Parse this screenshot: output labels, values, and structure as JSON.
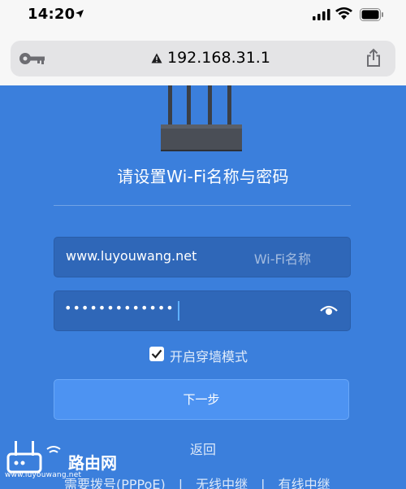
{
  "status_bar": {
    "time": "14:20"
  },
  "browser": {
    "url": "192.168.31.1"
  },
  "setup": {
    "title": "请设置Wi-Fi名称与密码",
    "ssid_value": "www.luyouwang.net",
    "ssid_hint": "Wi-Fi名称",
    "password_masked": "•••••••••••••",
    "wall_mode_label": "开启穿墙模式",
    "wall_mode_checked": true,
    "next_button": "下一步",
    "back_link": "返回",
    "links": [
      "需要拨号(PPPoE)",
      "无线中继",
      "有线中继"
    ]
  },
  "watermark": {
    "brand": "路由网",
    "url": "www.luyouwang.net"
  },
  "icons": {
    "key": "key-icon",
    "warning": "warning-icon",
    "share": "share-icon",
    "eye": "eye-icon",
    "checkmark": "checkmark-icon",
    "location": "location-arrow-icon",
    "signal": "signal-icon",
    "wifi": "wifi-icon",
    "battery": "battery-icon"
  },
  "colors": {
    "page_background": "#3b7fdc",
    "input_background": "#2f67b8",
    "button_background": "#4d93f2",
    "urlbar_background": "#e4e4e6"
  }
}
